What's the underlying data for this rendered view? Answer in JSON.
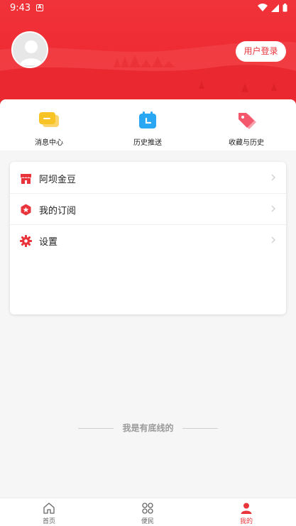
{
  "status_bar": {
    "time": "9:43",
    "notif_letter": "A"
  },
  "header": {
    "login_label": "用户登录"
  },
  "quick_tiles": [
    {
      "label": "消息中心",
      "icon": "message-icon",
      "color": "#f7c325"
    },
    {
      "label": "历史推送",
      "icon": "calendar-icon",
      "color": "#2aa7f2"
    },
    {
      "label": "收藏与历史",
      "icon": "tag-icon",
      "color": "#f4566b"
    }
  ],
  "menu": [
    {
      "label": "阿坝金豆",
      "icon": "shop-icon"
    },
    {
      "label": "我的订阅",
      "icon": "star-badge-icon"
    },
    {
      "label": "设置",
      "icon": "gear-icon"
    }
  ],
  "footer_text": "我是有底线的",
  "tabbar": [
    {
      "label": "首页",
      "icon": "home-icon"
    },
    {
      "label": "便民",
      "icon": "grid-icon"
    },
    {
      "label": "我的",
      "icon": "user-icon",
      "active": true
    }
  ],
  "colors": {
    "brand": "#e8343a",
    "header": "#ef2a31"
  }
}
